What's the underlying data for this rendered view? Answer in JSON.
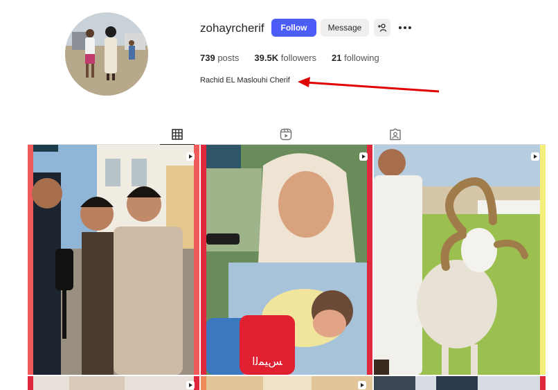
{
  "profile": {
    "username": "zohayrcherif",
    "follow_label": "Follow",
    "message_label": "Message",
    "full_name": "Rachid EL Maslouhi Cherif",
    "stats": [
      {
        "value": "739",
        "label": "posts"
      },
      {
        "value": "39.5K",
        "label": "followers"
      },
      {
        "value": "21",
        "label": "following"
      }
    ]
  },
  "icons": {
    "suggest": "add-person-icon",
    "more": "more-options-icon",
    "posts_tab": "grid-icon",
    "reels_tab": "reels-icon",
    "tagged_tab": "tagged-icon",
    "reel_badge": "reel-badge-icon"
  },
  "colors": {
    "follow_button": "#4c5cf6",
    "annotation_arrow": "#e00000"
  },
  "grid": {
    "tiles": [
      {
        "id": "tile-1",
        "overlay_text": ""
      },
      {
        "id": "tile-2",
        "overlay_text": "ﺲﻴﻤﻟﺍ"
      },
      {
        "id": "tile-3",
        "overlay_text": ""
      }
    ]
  }
}
